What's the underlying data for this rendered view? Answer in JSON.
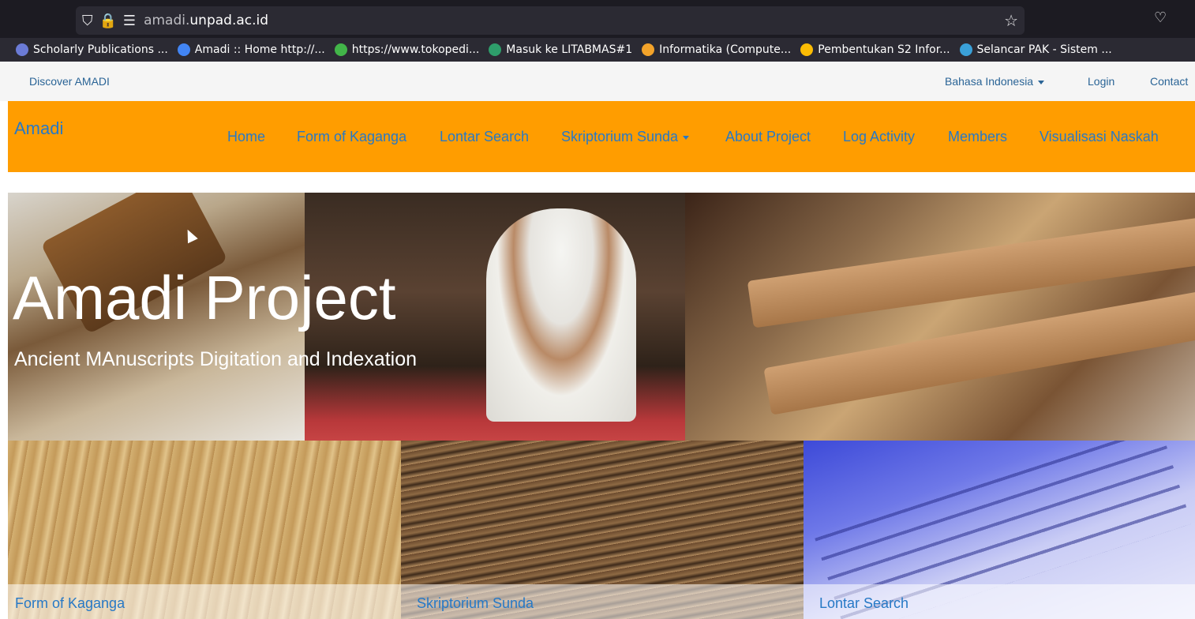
{
  "browser": {
    "url_domain_prefix": "amadi.",
    "url_domain_main": "unpad.ac.id",
    "bookmarks": [
      {
        "label": "Scholarly Publications ...",
        "color": "#6b7bd6"
      },
      {
        "label": "Amadi :: Home  http://...",
        "color": "#4285f4"
      },
      {
        "label": "https://www.tokopedi...",
        "color": "#42b549"
      },
      {
        "label": "Masuk ke LITABMAS#1",
        "color": "#2e9e6b"
      },
      {
        "label": "Informatika (Compute...",
        "color": "#f3a32a"
      },
      {
        "label": "Pembentukan S2 Infor...",
        "color": "#fbbc04"
      },
      {
        "label": "Selancar PAK - Sistem ...",
        "color": "#3aa0d8"
      }
    ]
  },
  "topbar": {
    "discover": "Discover AMADI",
    "language": "Bahasa Indonesia",
    "login": "Login",
    "contact": "Contact"
  },
  "navbar": {
    "brand": "Amadi",
    "items": [
      {
        "label": "Home"
      },
      {
        "label": "Form of Kaganga"
      },
      {
        "label": "Lontar Search"
      },
      {
        "label": "Skriptorium Sunda"
      },
      {
        "label": "About Project"
      },
      {
        "label": "Log Activity"
      },
      {
        "label": "Members"
      },
      {
        "label": "Visualisasi Naskah"
      }
    ]
  },
  "hero": {
    "title": "Amadi Project",
    "subtitle": "Ancient MAnuscripts Digitation and Indexation"
  },
  "tiles": [
    {
      "caption": "Form of Kaganga"
    },
    {
      "caption": "Skriptorium Sunda"
    },
    {
      "caption": "Lontar Search"
    }
  ]
}
